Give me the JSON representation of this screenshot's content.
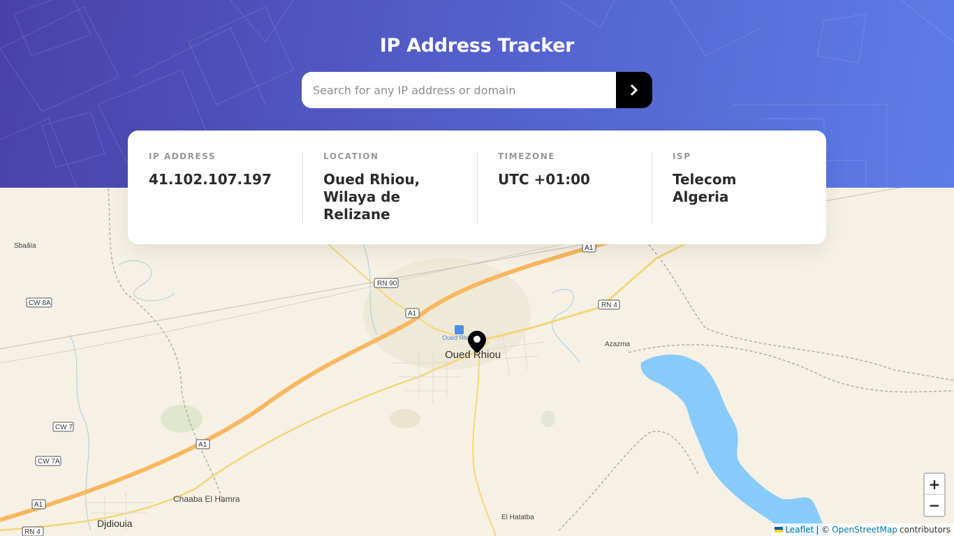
{
  "header": {
    "title": "IP Address Tracker",
    "search_placeholder": "Search for any IP address or domain",
    "search_value": ""
  },
  "info": {
    "ip_label": "IP ADDRESS",
    "ip_value": "41.102.107.197",
    "location_label": "LOCATION",
    "location_value": "Oued Rhiou, Wilaya de Relizane",
    "timezone_label": "TIMEZONE",
    "timezone_value": "UTC +01:00",
    "isp_label": "ISP",
    "isp_value": "Telecom Algeria"
  },
  "map": {
    "place_labels": [
      "Sbaâïa",
      "Oued Rhiou",
      "Azazma",
      "Chaaba El Hamra",
      "Djdiouia",
      "El Hatatba",
      "Oued Rhi"
    ],
    "road_labels": [
      "A1",
      "RN 90",
      "A1",
      "RN 4",
      "CW 8A",
      "CW 7",
      "CW 7A",
      "A1",
      "A1",
      "RN 4"
    ],
    "zoom_in": "+",
    "zoom_out": "−",
    "attribution": {
      "leaflet": "Leaflet",
      "sep": "| ©",
      "osm": "OpenStreetMap",
      "contributors": "contributors"
    }
  },
  "colors": {
    "header_start": "#4a41a8",
    "header_end": "#5e7de8",
    "water": "#86cbfb",
    "motorway": "#f8b861"
  }
}
